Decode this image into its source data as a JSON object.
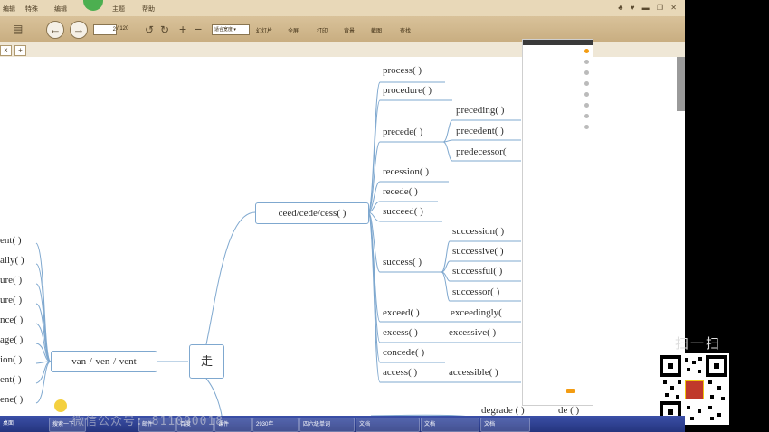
{
  "menubar": {
    "items": [
      "编辑",
      "特殊",
      "编辑",
      "主题",
      "帮助"
    ],
    "window_controls": "♣ ♥ ▬ ❐ ✕"
  },
  "toolbar": {
    "page_current": "2",
    "page_total": "/ 120",
    "zoom_value": "适合宽度",
    "buttons": {
      "rotate_left": "↺",
      "rotate_right": "↻",
      "zoom_in": "+",
      "zoom_out": "−",
      "copy_image": "幻灯片",
      "fullscreen": "全屏",
      "print": "打印",
      "background": "背景",
      "screenshot": "截图",
      "find": "查找"
    }
  },
  "tabs": [
    "×",
    "+"
  ],
  "mindmap": {
    "center": "走",
    "left_branch": "-van-/-ven-/-vent-",
    "left_words": [
      "ent(   )",
      "ally(   )",
      "ure(   )",
      "ure(   )",
      "nce(   )",
      "age(   )",
      "ion(   )",
      "ent(   )",
      "ene(   )"
    ],
    "ceed_branch": "ceed/cede/cess(    )",
    "words": {
      "process": "process(    )",
      "procedure": "procedure(    )",
      "precede": "precede(    )",
      "preceding": "preceding(    )",
      "precedent": "precedent(    )",
      "predecessor": "predecessor(",
      "recession": "recession(    )",
      "recede": "recede(    )",
      "succeed": "succeed(    )",
      "success": "success(    )",
      "succession": "succession(    )",
      "successive": "successive(    )",
      "successful": "successful(    )",
      "successor": "successor(    )",
      "exceed": "exceed(    )",
      "exceedingly": "exceedingly(",
      "excess": "excess(    )",
      "excessive": "excessive(    )",
      "concede": "concede(    )",
      "access": "access(    )",
      "accessible": "accessible(    )",
      "degrade": "degrade (    )",
      "de": "de (    )"
    }
  },
  "overlay": {
    "qr_caption": "扫一扫"
  },
  "taskbar": {
    "start": "桌面",
    "items": [
      "搜索一下",
      "邮件",
      "百度",
      "课件",
      "2930年",
      "四六级单词",
      "文档",
      "文档",
      "文档"
    ]
  },
  "watermark": "微信公众号: 811090018"
}
